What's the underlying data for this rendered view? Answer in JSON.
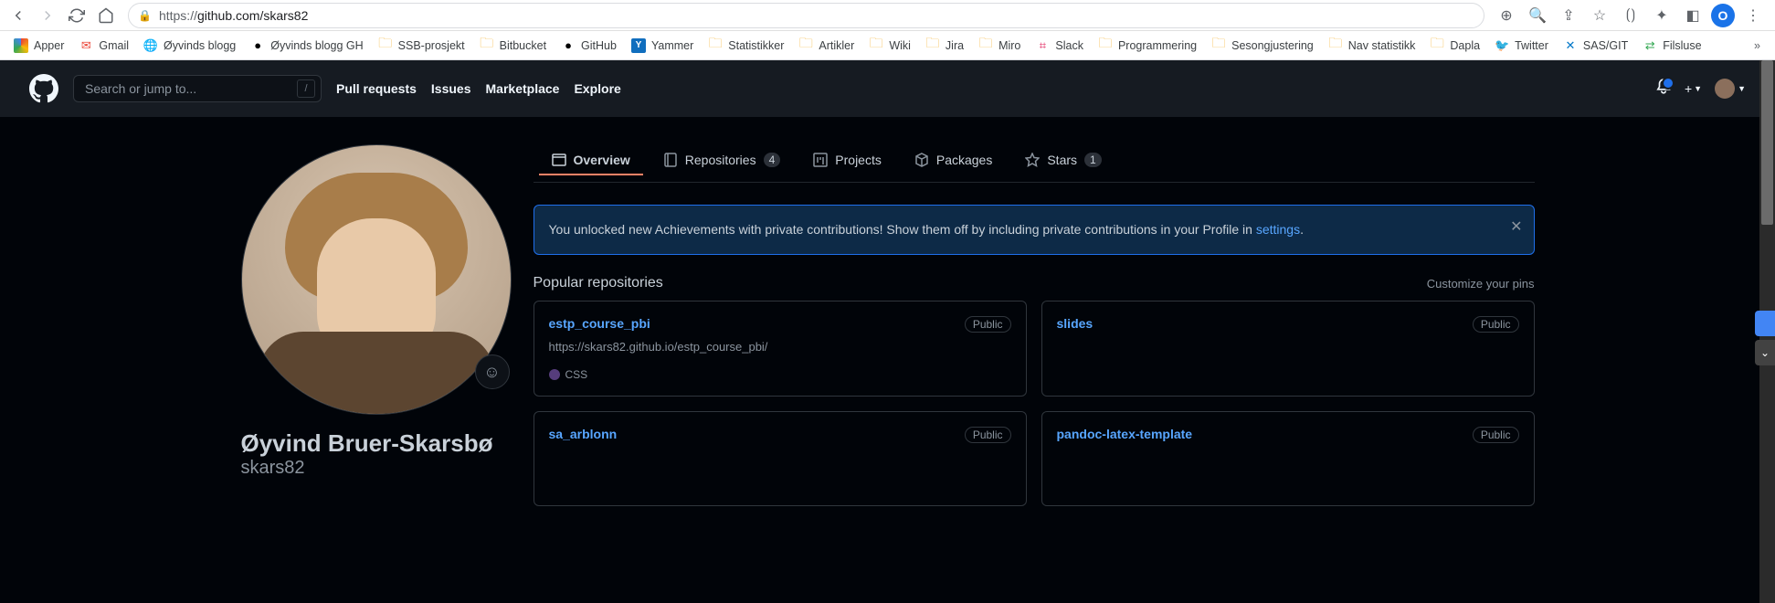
{
  "browser": {
    "url_proto": "https://",
    "url_rest": "github.com/skars82",
    "profile_letter": "O"
  },
  "bookmarks": [
    {
      "label": "Apper",
      "icon": "apps"
    },
    {
      "label": "Gmail",
      "icon": "gmail"
    },
    {
      "label": "Øyvinds blogg",
      "icon": "globe"
    },
    {
      "label": "Øyvinds blogg GH",
      "icon": "github"
    },
    {
      "label": "SSB-prosjekt",
      "icon": "folder"
    },
    {
      "label": "Bitbucket",
      "icon": "folder"
    },
    {
      "label": "GitHub",
      "icon": "github"
    },
    {
      "label": "Yammer",
      "icon": "yammer"
    },
    {
      "label": "Statistikker",
      "icon": "folder"
    },
    {
      "label": "Artikler",
      "icon": "folder"
    },
    {
      "label": "Wiki",
      "icon": "folder"
    },
    {
      "label": "Jira",
      "icon": "folder"
    },
    {
      "label": "Miro",
      "icon": "folder"
    },
    {
      "label": "Slack",
      "icon": "slack"
    },
    {
      "label": "Programmering",
      "icon": "folder"
    },
    {
      "label": "Sesongjustering",
      "icon": "folder"
    },
    {
      "label": "Nav statistikk",
      "icon": "folder"
    },
    {
      "label": "Dapla",
      "icon": "folder"
    },
    {
      "label": "Twitter",
      "icon": "twitter"
    },
    {
      "label": "SAS/GIT",
      "icon": "sas"
    },
    {
      "label": "Filsluse",
      "icon": "filsluse"
    }
  ],
  "gh_header": {
    "search_placeholder": "Search or jump to...",
    "slash": "/",
    "nav": [
      "Pull requests",
      "Issues",
      "Marketplace",
      "Explore"
    ]
  },
  "profile": {
    "name": "Øyvind Bruer-Skarsbø",
    "username": "skars82"
  },
  "tabs": [
    {
      "label": "Overview",
      "count": null,
      "active": true
    },
    {
      "label": "Repositories",
      "count": "4",
      "active": false
    },
    {
      "label": "Projects",
      "count": null,
      "active": false
    },
    {
      "label": "Packages",
      "count": null,
      "active": false
    },
    {
      "label": "Stars",
      "count": "1",
      "active": false
    }
  ],
  "banner": {
    "text_before": "You unlocked new Achievements with private contributions! Show them off by including private contributions in your Profile in ",
    "link": "settings",
    "text_after": "."
  },
  "repos_section": {
    "title": "Popular repositories",
    "customize": "Customize your pins"
  },
  "repos": [
    {
      "name": "estp_course_pbi",
      "visibility": "Public",
      "desc": "https://skars82.github.io/estp_course_pbi/",
      "lang": "CSS",
      "lang_color": "#563d7c"
    },
    {
      "name": "slides",
      "visibility": "Public",
      "desc": "",
      "lang": "",
      "lang_color": ""
    },
    {
      "name": "sa_arblonn",
      "visibility": "Public",
      "desc": "",
      "lang": "",
      "lang_color": ""
    },
    {
      "name": "pandoc-latex-template",
      "visibility": "Public",
      "desc": "",
      "lang": "",
      "lang_color": ""
    }
  ]
}
